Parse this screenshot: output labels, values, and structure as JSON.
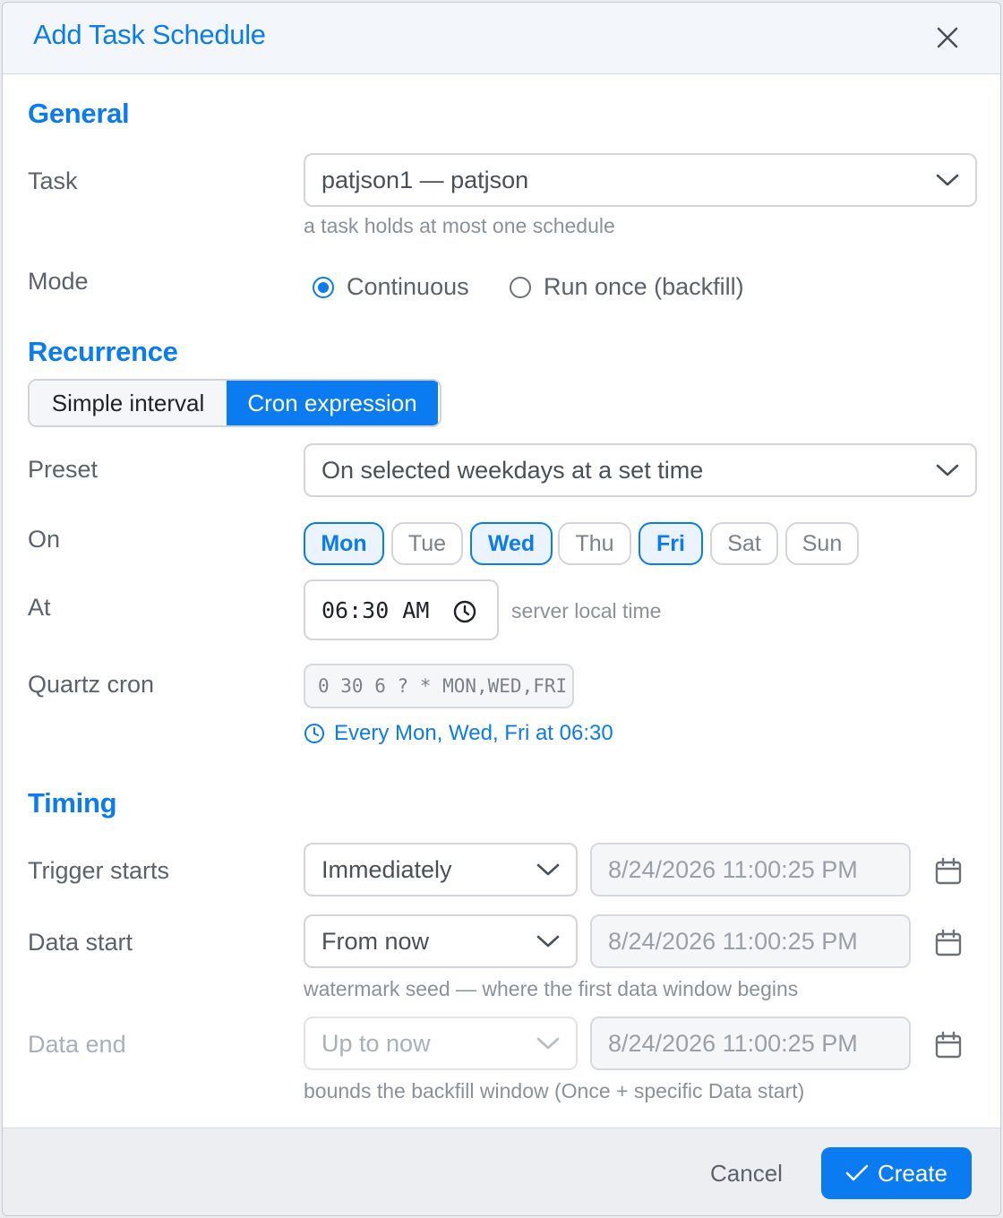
{
  "dialog": {
    "title": "Add Task Schedule"
  },
  "general": {
    "section": "General",
    "task_label": "Task",
    "task_value": "patjson1 — patjson",
    "task_hint": "a task holds at most one schedule",
    "mode_label": "Mode",
    "mode_options": [
      "Continuous",
      "Run once (backfill)"
    ],
    "mode_selected": "Continuous"
  },
  "recurrence": {
    "section": "Recurrence",
    "tabs": [
      "Simple interval",
      "Cron expression"
    ],
    "active_tab": "Cron expression",
    "preset_label": "Preset",
    "preset_value": "On selected weekdays at a set time",
    "on_label": "On",
    "days": [
      {
        "label": "Mon",
        "selected": true
      },
      {
        "label": "Tue",
        "selected": false
      },
      {
        "label": "Wed",
        "selected": true
      },
      {
        "label": "Thu",
        "selected": false
      },
      {
        "label": "Fri",
        "selected": true
      },
      {
        "label": "Sat",
        "selected": false
      },
      {
        "label": "Sun",
        "selected": false
      }
    ],
    "at_label": "At",
    "at_value": "06:30 AM",
    "at_hint": "server local time",
    "cron_label": "Quartz cron",
    "cron_value": "0 30 6 ? * MON,WED,FRI",
    "cron_summary": "Every Mon, Wed, Fri at 06:30"
  },
  "timing": {
    "section": "Timing",
    "trigger_label": "Trigger starts",
    "trigger_value": "Immediately",
    "trigger_datetime": "8/24/2026 11:00:25 PM",
    "data_start_label": "Data start",
    "data_start_value": "From now",
    "data_start_datetime": "8/24/2026 11:00:25 PM",
    "data_start_hint": "watermark seed — where the first data window begins",
    "data_end_label": "Data end",
    "data_end_value": "Up to now",
    "data_end_datetime": "8/24/2026 11:00:25 PM",
    "data_end_hint": "bounds the backfill window (Once + specific Data start)"
  },
  "footer": {
    "cancel_label": "Cancel",
    "create_label": "Create"
  },
  "colors": {
    "accent": "#0a7bf0",
    "selected_day_bg": "#eaf3fe"
  }
}
